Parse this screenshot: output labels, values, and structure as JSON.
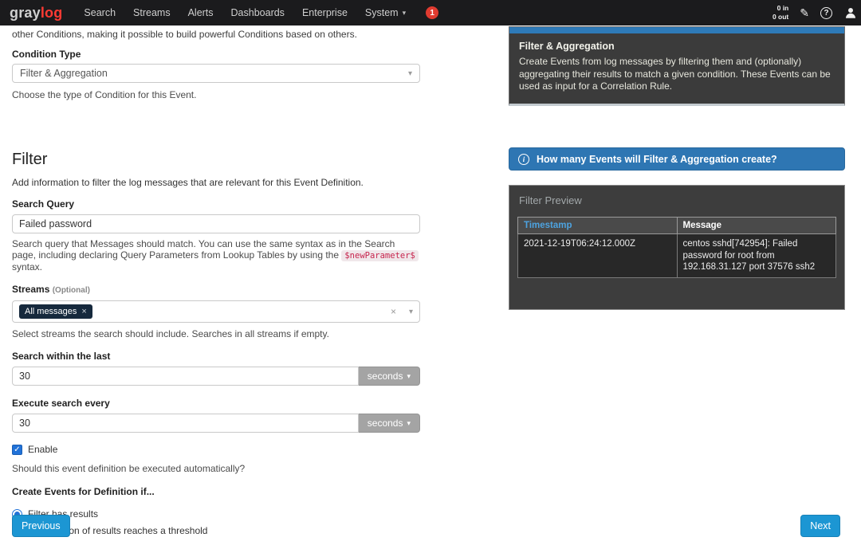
{
  "navbar": {
    "logo_gray": "gray",
    "logo_red": "log",
    "items": [
      "Search",
      "Streams",
      "Alerts",
      "Dashboards",
      "Enterprise",
      "System"
    ],
    "badge": "1",
    "throughput_in": "0 in",
    "throughput_out": "0 out"
  },
  "icons": {
    "caret": "▾",
    "close": "×",
    "check": "✓",
    "info": "i",
    "help": "?",
    "edit": "✎"
  },
  "intro_text": "other Conditions, making it possible to build powerful Conditions based on others.",
  "condition_type": {
    "label": "Condition Type",
    "value": "Filter & Aggregation",
    "help": "Choose the type of Condition for this Event."
  },
  "filter_section": {
    "title": "Filter",
    "description": "Add information to filter the log messages that are relevant for this Event Definition.",
    "search_query": {
      "label": "Search Query",
      "value": "Failed password",
      "help_before": "Search query that Messages should match. You can use the same syntax as in the Search page, including declaring Query Parameters from Lookup Tables by using the ",
      "help_code": "$newParameter$",
      "help_after": " syntax."
    },
    "streams": {
      "label": "Streams",
      "optional": "(Optional)",
      "tag": "All messages",
      "help": "Select streams the search should include. Searches in all streams if empty."
    },
    "search_within": {
      "label": "Search within the last",
      "value": "30",
      "unit": "seconds"
    },
    "execute_every": {
      "label": "Execute search every",
      "value": "30",
      "unit": "seconds"
    },
    "enable": {
      "label": "Enable",
      "help": "Should this event definition be executed automatically?"
    },
    "create_events": {
      "label": "Create Events for Definition if...",
      "options": [
        {
          "label": "Filter has results"
        },
        {
          "label": "Aggregation of results reaches a threshold"
        }
      ]
    }
  },
  "footer": {
    "previous": "Previous",
    "next": "Next"
  },
  "right_panel": {
    "doc": {
      "title": "Filter & Aggregation",
      "body": "Create Events from log messages by filtering them and (optionally) aggregating their results to match a given condition. These Events can be used as input for a Correlation Rule."
    },
    "info_bar": "How many Events will Filter & Aggregation create?",
    "filter_preview": {
      "title": "Filter Preview",
      "columns": [
        "Timestamp",
        "Message"
      ],
      "rows": [
        {
          "timestamp": "2021-12-19T06:24:12.000Z",
          "message": "centos sshd[742954]: Failed password for root from 192.168.31.127 port 37576 ssh2"
        }
      ]
    }
  },
  "colors": {
    "navbar_bg": "#1b1b1d",
    "brand_red": "#ff3a33",
    "accent_blue": "#2e76b3",
    "button_blue": "#1c96d3",
    "timestamp_link": "#4da3e0",
    "panel_dark": "#3b3b3b"
  }
}
